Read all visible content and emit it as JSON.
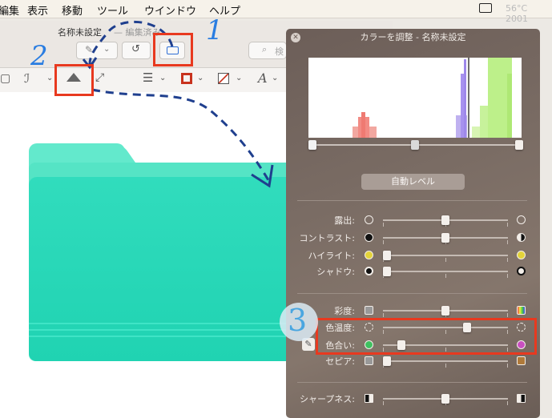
{
  "menubar": {
    "items": [
      "編集",
      "表示",
      "移動",
      "ツール",
      "ウインドウ",
      "ヘルプ"
    ],
    "status": "56°C 2001"
  },
  "document": {
    "title": "名称未設定",
    "subtitle": "— 編集済み",
    "search_placeholder": "検"
  },
  "adjust_panel": {
    "title": "カラーを調整 - 名称未設定",
    "auto_level_label": "自動レベル",
    "histogram_levels": {
      "black": 0.02,
      "mid": 0.5,
      "white": 0.99
    },
    "rows": [
      {
        "label": "露出:",
        "value": 0.5,
        "left_icon": "aperture-icon",
        "right_icon": "aperture-icon"
      },
      {
        "label": "コントラスト:",
        "value": 0.5,
        "left_icon": "filled-circle-icon",
        "right_icon": "half-circle-icon"
      },
      {
        "label": "ハイライト:",
        "value": 0.03,
        "left_icon": "yellow-dot-icon",
        "right_icon": "yellow-dot-icon"
      },
      {
        "label": "シャドウ:",
        "value": 0.03,
        "left_icon": "dot-icon",
        "right_icon": "ring-icon"
      },
      {
        "label": "彩度:",
        "value": 0.5,
        "left_icon": "gray-swatch-icon",
        "right_icon": "color-swatch-icon"
      },
      {
        "label": "色温度:",
        "value": 0.67,
        "left_icon": "sun-icon",
        "right_icon": "sun-icon"
      },
      {
        "label": "色合い:",
        "value": 0.15,
        "left_icon": "green-dot-icon",
        "right_icon": "magenta-dot-icon"
      },
      {
        "label": "セピア:",
        "value": 0.03,
        "left_icon": "gray-swatch-icon",
        "right_icon": "sepia-swatch-icon"
      },
      {
        "label": "シャープネス:",
        "value": 0.5,
        "left_icon": "blur-box-icon",
        "right_icon": "sharp-box-icon"
      }
    ]
  },
  "annotations": {
    "one": "1",
    "two": "2",
    "three": "3"
  },
  "colors": {
    "folder_top": "#5be7c7",
    "folder_main": "#22d8b6",
    "highlight": "#e8391f",
    "note": "#2a7de1"
  }
}
